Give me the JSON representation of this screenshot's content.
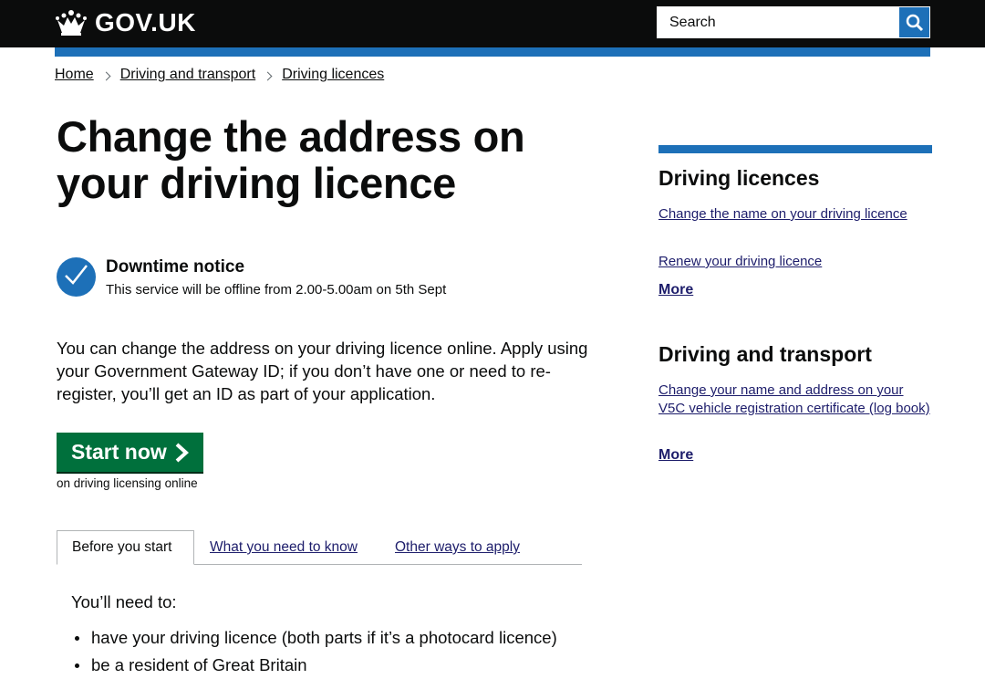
{
  "header": {
    "logo_text": "GOV.UK",
    "search_placeholder": "Search"
  },
  "breadcrumb": [
    "Home",
    "Driving and transport",
    "Driving licences"
  ],
  "page_title": "Change the address on your driving licence",
  "notice": {
    "title": "Downtime notice",
    "text": "This service will be offline from 2.00-5.00am on 5th Sept"
  },
  "intro": "You can change the address on your driving licence online. Apply using your Government Gateway ID; if you don’t have one or need to re-register, you’ll get an ID as part of your application.",
  "start": {
    "label": "Start now",
    "subtext": "on driving licensing online"
  },
  "tabs": [
    {
      "label": "Before you start"
    },
    {
      "label": "What you need to know"
    },
    {
      "label": "Other ways to apply"
    }
  ],
  "tab_content": {
    "heading": "You’ll need to:",
    "items": [
      "have your driving licence (both parts if it’s a photocard licence)",
      "be a resident of Great Britain"
    ]
  },
  "sidebar": {
    "sections": [
      {
        "heading": "Driving licences",
        "links": [
          "Change the name on your driving licence",
          "Renew your driving licence"
        ],
        "more": "More"
      },
      {
        "heading": "Driving and transport",
        "links": [
          "Change your name and address on your V5C vehicle registration certificate (log book)"
        ],
        "more": "More"
      }
    ]
  },
  "colors": {
    "header_bg": "#0b0c0c",
    "accent_blue": "#1d70b8",
    "start_green": "#00703c",
    "link": "#1d1d6b"
  },
  "icons": {
    "logo": "crown-icon",
    "search": "search-icon",
    "notice": "tick-icon",
    "start_arrow": "chevron-right-icon"
  }
}
